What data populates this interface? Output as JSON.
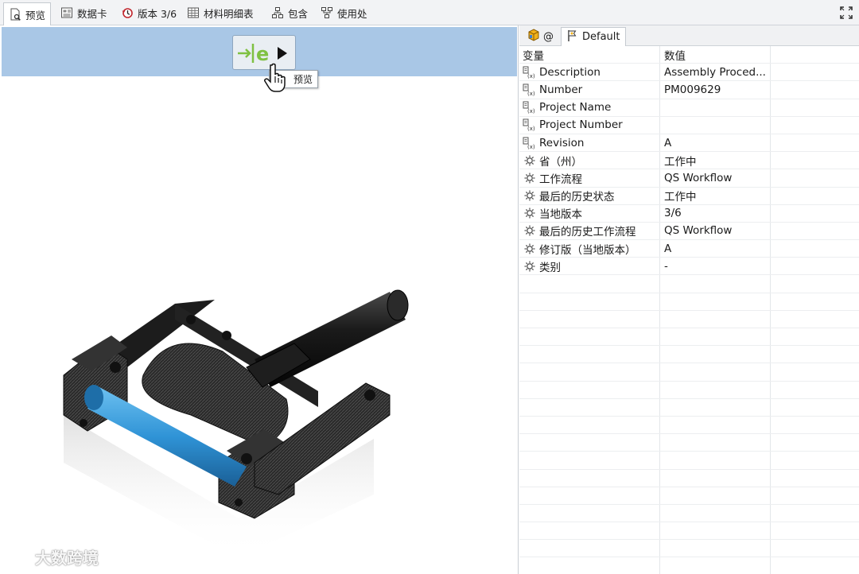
{
  "top_tabs": [
    {
      "label": "预览",
      "icon": "preview-doc-icon",
      "active": true
    },
    {
      "label": "数据卡",
      "icon": "datacard-icon",
      "active": false
    },
    {
      "label": "版本 3/6",
      "icon": "version-history-icon",
      "active": false
    },
    {
      "label": "材料明细表",
      "icon": "bom-table-icon",
      "active": false
    },
    {
      "label": "包含",
      "icon": "contains-tree-icon",
      "active": false
    },
    {
      "label": "使用处",
      "icon": "where-used-icon",
      "active": false
    }
  ],
  "preview": {
    "eview_button_icon": "edrawings-play-icon",
    "tooltip": "预览",
    "watermark": "大数跨境"
  },
  "properties": {
    "tabs": [
      {
        "label": "@",
        "icon": "config-cube-icon",
        "active": false
      },
      {
        "label": "Default",
        "icon": "config-flag-icon",
        "active": true
      }
    ],
    "columns": {
      "variable": "变量",
      "value": "数值"
    },
    "rows": [
      {
        "name": "Description",
        "value": "Assembly Proced...",
        "icon": "variable-icon"
      },
      {
        "name": "Number",
        "value": "PM009629",
        "icon": "variable-icon"
      },
      {
        "name": "Project Name",
        "value": "",
        "icon": "variable-icon"
      },
      {
        "name": "Project Number",
        "value": "",
        "icon": "variable-icon"
      },
      {
        "name": "Revision",
        "value": "A",
        "icon": "variable-icon"
      },
      {
        "name": "省（州）",
        "value": "工作中",
        "icon": "system-gear-icon"
      },
      {
        "name": "工作流程",
        "value": "QS Workflow",
        "icon": "system-gear-icon"
      },
      {
        "name": "最后的历史状态",
        "value": "工作中",
        "icon": "system-gear-icon"
      },
      {
        "name": "当地版本",
        "value": "3/6",
        "icon": "system-gear-icon"
      },
      {
        "name": "最后的历史工作流程",
        "value": "QS Workflow",
        "icon": "system-gear-icon"
      },
      {
        "name": "修订版（当地版本）",
        "value": "A",
        "icon": "system-gear-icon"
      },
      {
        "name": "类别",
        "value": "-",
        "icon": "system-gear-icon"
      }
    ]
  },
  "colors": {
    "preview_header": "#a9c7e6",
    "part_blue": "#2f93d6",
    "eview_green": "#7fc142"
  }
}
